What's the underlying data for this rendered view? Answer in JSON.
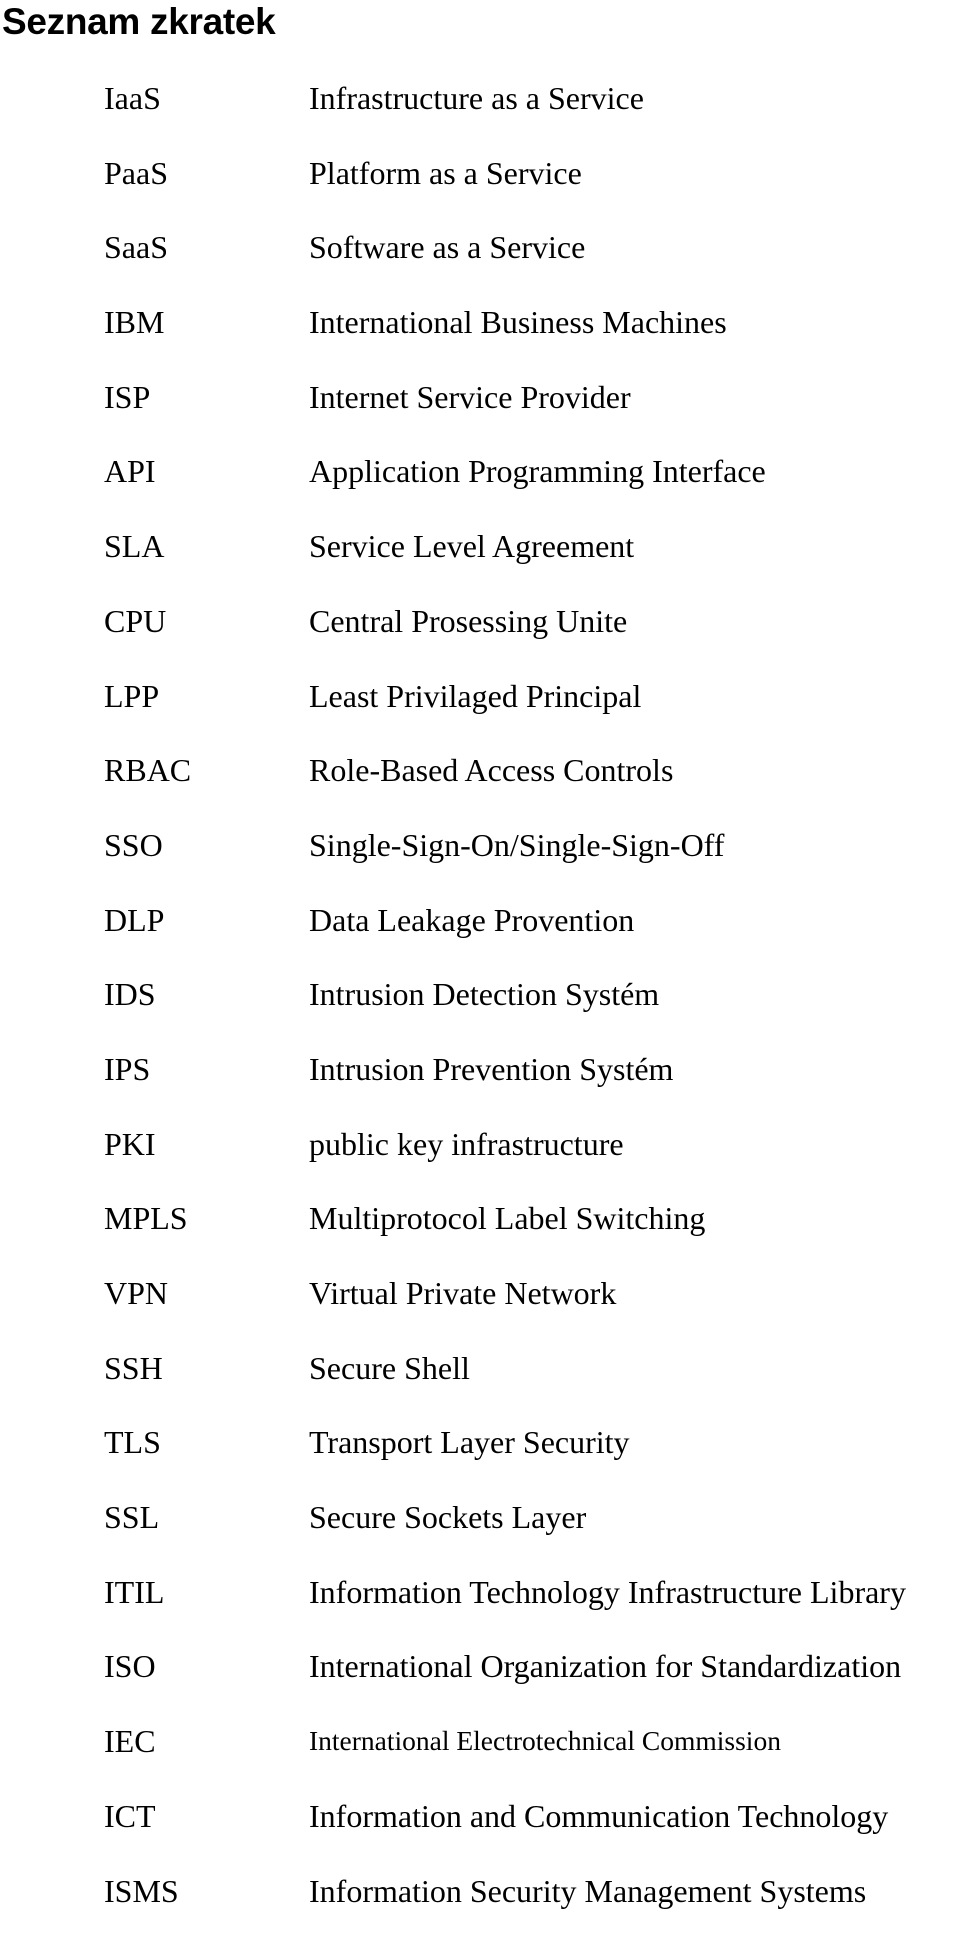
{
  "title": "Seznam zkratek",
  "entries": [
    {
      "abbr": "IaaS",
      "definition": "Infrastructure as a Service"
    },
    {
      "abbr": "PaaS",
      "definition": "Platform as a Service"
    },
    {
      "abbr": "SaaS",
      "definition": "Software as a Service"
    },
    {
      "abbr": "IBM",
      "definition": "International Business Machines"
    },
    {
      "abbr": "ISP",
      "definition": "Internet Service Provider"
    },
    {
      "abbr": "API",
      "definition": "Application Programming Interface"
    },
    {
      "abbr": "SLA",
      "definition": "Service Level Agreement"
    },
    {
      "abbr": "CPU",
      "definition": "Central Prosessing Unite"
    },
    {
      "abbr": "LPP",
      "definition": "Least Privilaged Principal"
    },
    {
      "abbr": "RBAC",
      "definition": "Role-Based Access Controls"
    },
    {
      "abbr": "SSO",
      "definition": "Single-Sign-On/Single-Sign-Off"
    },
    {
      "abbr": "DLP",
      "definition": "Data Leakage Provention"
    },
    {
      "abbr": "IDS",
      "definition": "Intrusion Detection Systém"
    },
    {
      "abbr": "IPS",
      "definition": "Intrusion Prevention Systém"
    },
    {
      "abbr": "PKI",
      "definition": "public key infrastructure"
    },
    {
      "abbr": "MPLS",
      "definition": "Multiprotocol Label Switching"
    },
    {
      "abbr": "VPN",
      "definition": "Virtual Private Network"
    },
    {
      "abbr": "SSH",
      "definition": "Secure Shell"
    },
    {
      "abbr": "TLS",
      "definition": "Transport Layer Security"
    },
    {
      "abbr": "SSL",
      "definition": "Secure Sockets Layer"
    },
    {
      "abbr": "ITIL",
      "definition": "Information Technology Infrastructure Library"
    },
    {
      "abbr": "ISO",
      "definition": "International Organization for Standardization"
    },
    {
      "abbr": "IEC",
      "definition": "International Electrotechnical Commission"
    },
    {
      "abbr": "ICT",
      "definition": "Information and Communication Technology"
    },
    {
      "abbr": "ISMS",
      "definition": "Information Security Management Systems"
    }
  ]
}
